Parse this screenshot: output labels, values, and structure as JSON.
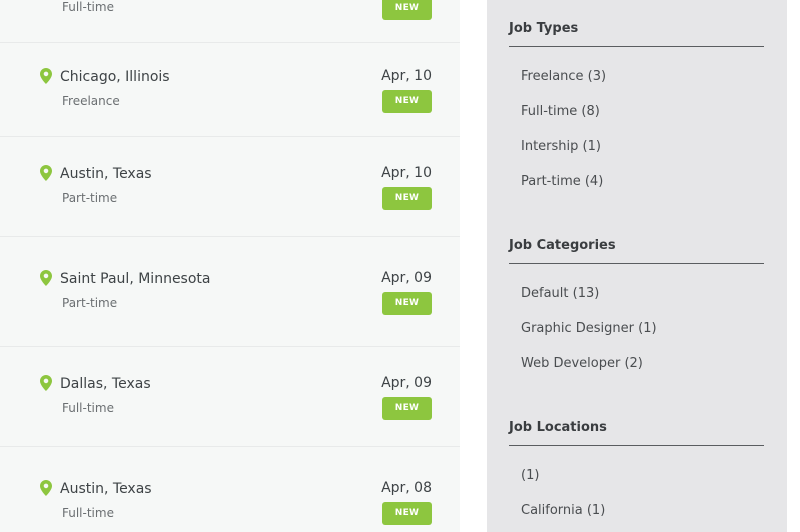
{
  "jobs": [
    {
      "location": "",
      "type": "Full-time",
      "date": "",
      "badge": "NEW"
    },
    {
      "location": "Chicago, Illinois",
      "type": "Freelance",
      "date": "Apr, 10",
      "badge": "NEW"
    },
    {
      "location": "Austin, Texas",
      "type": "Part-time",
      "date": "Apr, 10",
      "badge": "NEW"
    },
    {
      "location": "Saint Paul, Minnesota",
      "type": "Part-time",
      "date": "Apr, 09",
      "badge": "NEW"
    },
    {
      "location": "Dallas, Texas",
      "type": "Full-time",
      "date": "Apr, 09",
      "badge": "NEW"
    },
    {
      "location": "Austin, Texas",
      "type": "Full-time",
      "date": "Apr, 08",
      "badge": "NEW"
    }
  ],
  "sidebar": {
    "job_types": {
      "title": "Job Types",
      "items": [
        "Freelance (3)",
        "Full-time (8)",
        "Intership (1)",
        "Part-time (4)"
      ]
    },
    "job_categories": {
      "title": "Job Categories",
      "items": [
        "Default (13)",
        "Graphic Designer (1)",
        "Web Developer (2)"
      ]
    },
    "job_locations": {
      "title": "Job Locations",
      "items": [
        "(1)",
        "California (1)"
      ]
    }
  },
  "colors": {
    "accent": "#8dc63f",
    "list_bg": "#f6f8f7",
    "sidebar_bg": "#e6e6e8"
  }
}
